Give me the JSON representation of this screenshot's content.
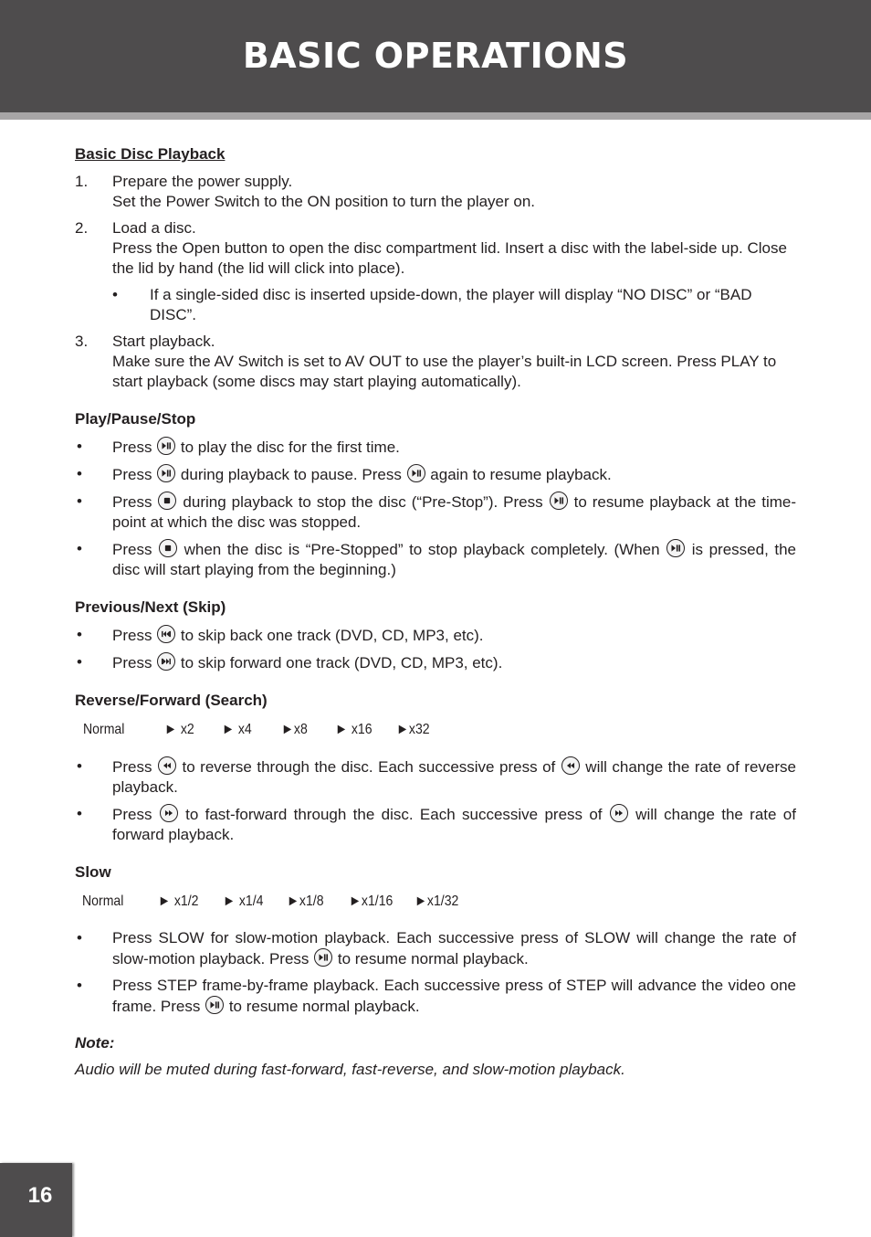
{
  "header": {
    "title": "BASIC OPERATIONS"
  },
  "sections": {
    "basic": {
      "title": "Basic Disc Playback",
      "steps": [
        {
          "num": "1.",
          "line1": "Prepare the power supply.",
          "line2": "Set the Power Switch to the ON position to turn the player on."
        },
        {
          "num": "2.",
          "line1": "Load a disc.",
          "line2": "Press the Open button to open the disc compartment lid. Insert a disc with the label-side up. Close the lid by hand (the lid will click into place).",
          "sub": "If a single-sided disc is inserted upside-down, the player will display “NO DISC” or “BAD DISC”."
        },
        {
          "num": "3.",
          "line1": "Start playback.",
          "line2": "Make sure the AV Switch is set to AV OUT to use the player’s built-in LCD screen. Press PLAY to start playback (some discs may start playing automatically)."
        }
      ]
    },
    "play": {
      "title": "Play/Pause/Stop",
      "items": [
        {
          "a": "Press ",
          "b": " to play the disc for the first time."
        },
        {
          "a": "Press ",
          "b": " during playback to pause. Press ",
          "c": " again to resume playback."
        },
        {
          "a": "Press ",
          "b": " during playback to stop the disc (“Pre-Stop”). Press ",
          "c": " to resume playback at the time-point at which the disc was stopped."
        },
        {
          "a": "Press ",
          "b": " when the disc is “Pre-Stopped” to stop playback completely. (When ",
          "c": " is pressed, the disc will start playing from the beginning.)"
        }
      ]
    },
    "skip": {
      "title": "Previous/Next (Skip)",
      "items": [
        {
          "a": "Press ",
          "b": " to skip back one track (DVD, CD, MP3, etc)."
        },
        {
          "a": "Press ",
          "b": " to skip forward one track (DVD, CD,  MP3, etc)."
        }
      ]
    },
    "search": {
      "title": "Reverse/Forward (Search)",
      "speeds": [
        "Normal",
        "► x2",
        "► x4",
        "►x8",
        "► x16",
        "►x32"
      ],
      "items": [
        {
          "a": "Press ",
          "b": " to reverse through the disc. Each successive press of ",
          "c": " will change the rate of reverse playback."
        },
        {
          "a": "Press ",
          "b": " to fast-forward through the disc. Each successive press of ",
          "c": " will change the rate of forward playback."
        }
      ]
    },
    "slow": {
      "title": "Slow",
      "speeds": [
        "Normal",
        "► x1/2",
        "► x1/4",
        "►x1/8",
        "►x1/16",
        "►x1/32"
      ],
      "items": [
        {
          "a": "Press SLOW for slow-motion playback. Each successive press of SLOW will change the rate of slow-motion playback. Press ",
          "b": " to resume normal playback."
        },
        {
          "a": "Press STEP frame-by-frame playback. Each successive press of STEP will advance the video one frame. Press ",
          "b": " to resume normal playback."
        }
      ]
    },
    "note": {
      "title": "Note:",
      "text": "Audio will be muted during fast-forward, fast-reverse, and slow-motion playback."
    }
  },
  "markers": {
    "bullet": "•"
  },
  "footer": {
    "page_number": "16"
  }
}
